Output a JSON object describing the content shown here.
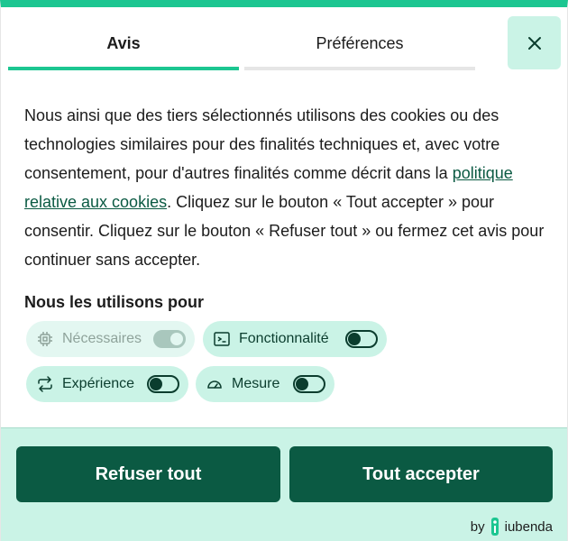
{
  "tabs": [
    {
      "label": "Avis",
      "active": true
    },
    {
      "label": "Préférences",
      "active": false
    }
  ],
  "notice": {
    "text_before_link": "Nous ainsi que des tiers sélectionnés utilisons des cookies ou des technologies similaires pour des finalités techniques et, avec votre consentement, pour d'autres finalités comme décrit dans la ",
    "link_text": "politique relative aux cookies",
    "text_after_link": ". Cliquez sur le bouton « Tout accepter » pour consentir. Cliquez sur le bouton « Refuser tout » ou fermez cet avis pour continuer sans accepter."
  },
  "purposes": {
    "title": "Nous les utilisons pour",
    "items": [
      {
        "label": "Nécessaires",
        "icon": "chip-icon",
        "enabled": true,
        "disabled": true
      },
      {
        "label": "Fonctionnalité",
        "icon": "terminal-icon",
        "enabled": false,
        "disabled": false
      },
      {
        "label": "Expérience",
        "icon": "arrows-swap-icon",
        "enabled": false,
        "disabled": false
      },
      {
        "label": "Mesure",
        "icon": "gauge-icon",
        "enabled": false,
        "disabled": false
      }
    ]
  },
  "buttons": {
    "reject": "Refuser tout",
    "accept": "Tout accepter"
  },
  "branding": {
    "prefix": "by",
    "name": "iubenda"
  },
  "colors": {
    "accent": "#1cc691",
    "primary": "#0b5a43",
    "chip_bg": "#caf3e6"
  }
}
